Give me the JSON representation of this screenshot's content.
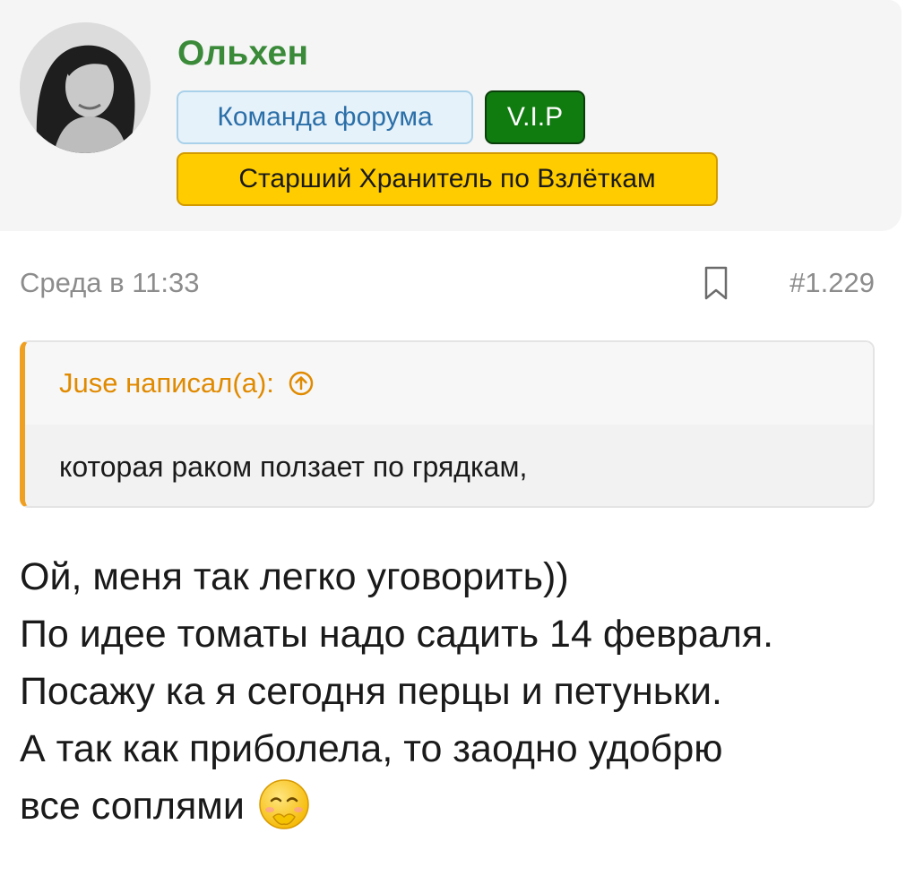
{
  "user": {
    "name": "Ольхен",
    "badges": {
      "team": "Команда форума",
      "vip": "V.I.P",
      "rank": "Старший Хранитель по Взлёткам"
    }
  },
  "post": {
    "date": "Среда в 11:33",
    "number": "#1.229",
    "quote": {
      "author_line": "Juse написал(а):",
      "text": "которая раком ползает по грядкам,"
    },
    "lines": [
      "Ой, меня так легко уговорить))",
      "По идее томаты надо садить 14 февраля.",
      "Посажу ка я сегодня перцы и петуньки.",
      "А так как приболела, то заодно удобрю",
      "все соплями"
    ],
    "emoji": "embarrassed-smile-emoji"
  },
  "colors": {
    "username": "#3a8a3a",
    "team_badge_bg": "#e6f2fa",
    "vip_badge_bg": "#107c10",
    "rank_badge_bg": "#ffcc00",
    "quote_accent": "#f0a020"
  }
}
